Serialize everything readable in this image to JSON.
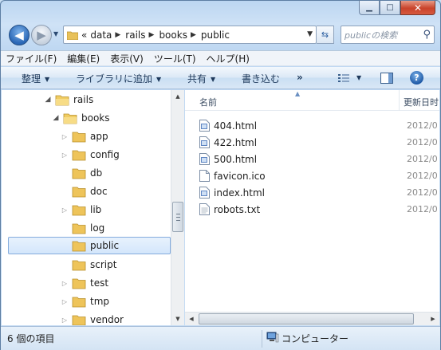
{
  "window": {
    "caption": {
      "minimize": "▁",
      "maximize": "□",
      "close": "✕"
    }
  },
  "address": {
    "overflow": "«",
    "crumbs": [
      "data",
      "rails",
      "books",
      "public"
    ],
    "search_placeholder": "publicの検索"
  },
  "menu": [
    "ファイル(F)",
    "編集(E)",
    "表示(V)",
    "ツール(T)",
    "ヘルプ(H)"
  ],
  "commands": {
    "organize": "整理",
    "library": "ライブラリに追加",
    "share": "共有",
    "burn": "書き込む",
    "more": "»",
    "help": "?"
  },
  "tree": [
    {
      "label": "rails",
      "expanded": true,
      "arrow": "◢"
    },
    {
      "label": "books",
      "expanded": true,
      "arrow": "◢"
    },
    {
      "label": "app",
      "arrow": "▷"
    },
    {
      "label": "config",
      "arrow": "▷"
    },
    {
      "label": "db",
      "arrow": ""
    },
    {
      "label": "doc",
      "arrow": ""
    },
    {
      "label": "lib",
      "arrow": "▷"
    },
    {
      "label": "log",
      "arrow": ""
    },
    {
      "label": "public",
      "arrow": "",
      "selected": true
    },
    {
      "label": "script",
      "arrow": ""
    },
    {
      "label": "test",
      "arrow": "▷"
    },
    {
      "label": "tmp",
      "arrow": "▷"
    },
    {
      "label": "vendor",
      "arrow": "▷"
    }
  ],
  "columns": {
    "name": "名前",
    "date": "更新日时"
  },
  "files": [
    {
      "name": "404.html",
      "date": "2012/0",
      "icon": "html-file-icon"
    },
    {
      "name": "422.html",
      "date": "2012/0",
      "icon": "html-file-icon"
    },
    {
      "name": "500.html",
      "date": "2012/0",
      "icon": "html-file-icon"
    },
    {
      "name": "favicon.ico",
      "date": "2012/0",
      "icon": "blank-file-icon"
    },
    {
      "name": "index.html",
      "date": "2012/0",
      "icon": "html-file-icon"
    },
    {
      "name": "robots.txt",
      "date": "2012/0",
      "icon": "text-file-icon"
    }
  ],
  "status": {
    "count": "6 個の項目",
    "location": "コンピューター"
  }
}
